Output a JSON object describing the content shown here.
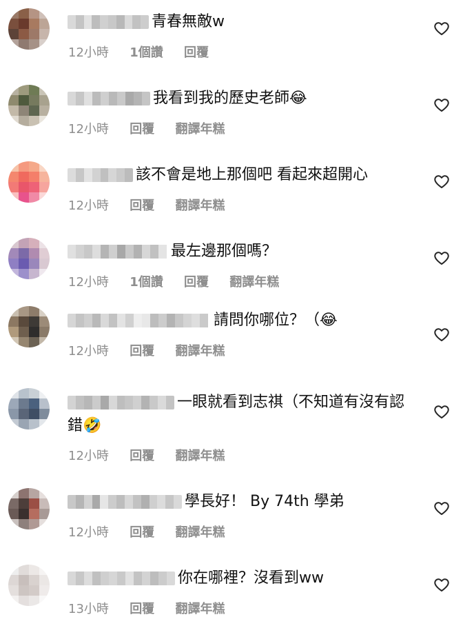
{
  "comments": [
    {
      "text": "青春無敵w",
      "time": "12小時",
      "likes": "1個讚",
      "reply": "回覆",
      "translate": ""
    },
    {
      "text": "我看到我的歷史老師😂",
      "time": "12小時",
      "likes": "",
      "reply": "回覆",
      "translate": "翻譯年糕"
    },
    {
      "text": "該不會是地上那個吧 看起來超開心",
      "time": "12小時",
      "likes": "",
      "reply": "回覆",
      "translate": "翻譯年糕"
    },
    {
      "text": "最左邊那個嗎？",
      "time": "12小時",
      "likes": "1個讚",
      "reply": "回覆",
      "translate": "翻譯年糕"
    },
    {
      "text": "請問你哪位？（😂",
      "time": "12小時",
      "likes": "",
      "reply": "回覆",
      "translate": "翻譯年糕"
    },
    {
      "text": "一眼就看到志祺（不知道有沒有認錯🤣",
      "time": "12小時",
      "likes": "",
      "reply": "回覆",
      "translate": "翻譯年糕"
    },
    {
      "text": "學長好！ By 74th 學弟",
      "time": "12小時",
      "likes": "",
      "reply": "回覆",
      "translate": "翻譯年糕"
    },
    {
      "text": "你在哪裡？沒看到ww",
      "time": "13小時",
      "likes": "",
      "reply": "回覆",
      "translate": "翻譯年糕"
    }
  ],
  "icons": {
    "like": "heart-outline-icon"
  },
  "colors": {
    "meta_text": "#8e8e8e",
    "text": "#111111",
    "icon": "#262626"
  }
}
